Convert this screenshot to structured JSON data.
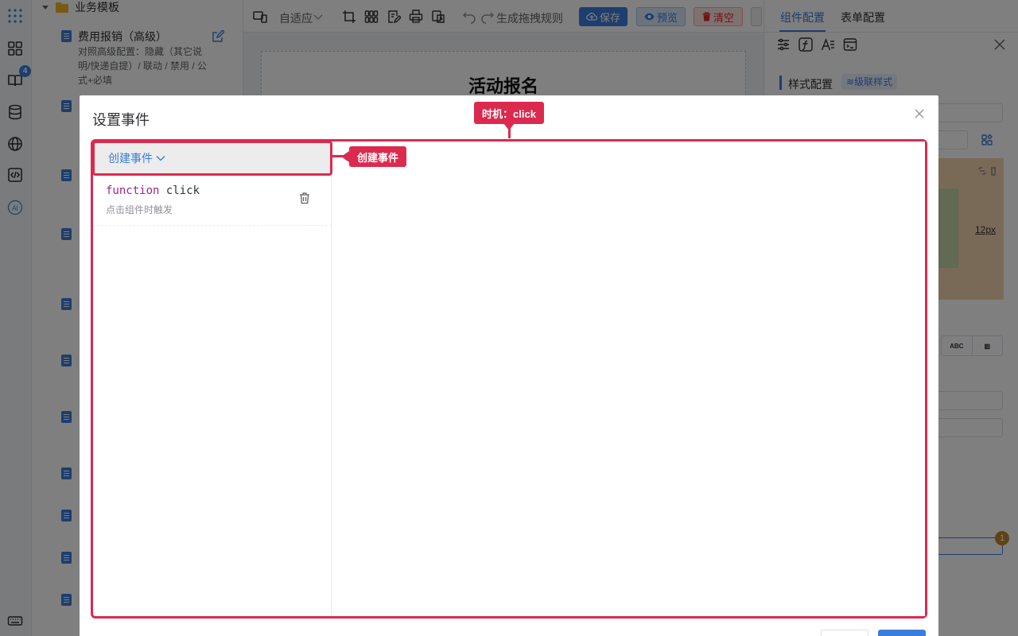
{
  "rail": {
    "badge_count": "4",
    "ai_label": "AI"
  },
  "sidebar": {
    "folder_label": "业务模板",
    "item_title": "费用报销（高级）",
    "item_desc": "对照高级配置：隐藏（其它说明/快递自提）/ 联动 / 禁用 / 公式+必填"
  },
  "toolbar": {
    "layout_label": "自适应",
    "rule_label": "生成拖拽规则",
    "save_label": "保存",
    "preview_label": "预览",
    "clear_label": "清空"
  },
  "canvas": {
    "form_title": "活动报名"
  },
  "right_panel": {
    "tabs": [
      "组件配置",
      "表单配置"
    ],
    "section_title": "样式配置",
    "cascade_label": "级联样式",
    "box_value": "12px",
    "abc_label": "ABC",
    "badge_count": "1"
  },
  "dialog": {
    "title": "设置事件",
    "create_label": "创建事件",
    "events": [
      {
        "keyword": "function",
        "name": "click",
        "desc": "点击组件时触发"
      }
    ]
  },
  "callouts": {
    "top": "时机：click",
    "left": "创建事件"
  },
  "colors": {
    "accent": "#3b7ddd",
    "callout": "#dc2a4f",
    "danger": "#e0292b"
  }
}
